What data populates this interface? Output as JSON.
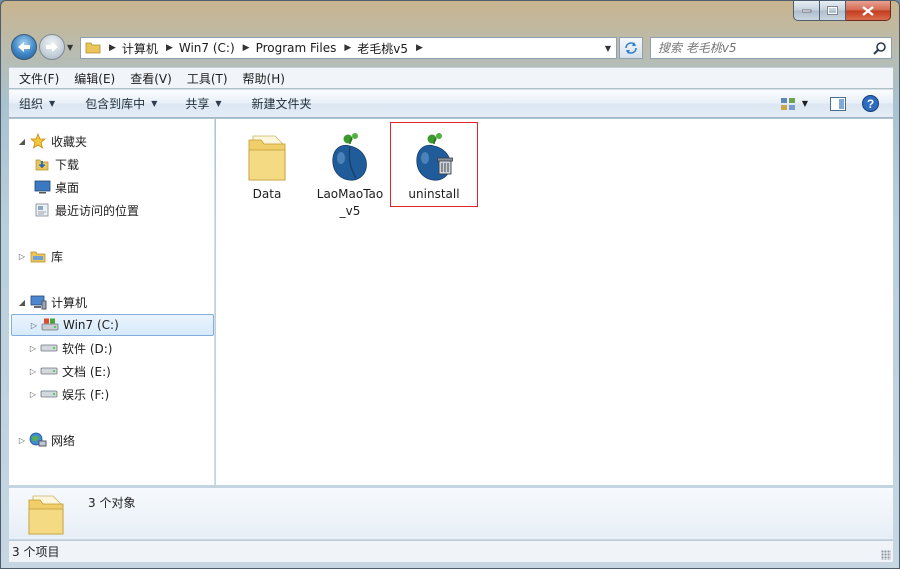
{
  "window": {
    "caption_buttons": [
      "minimize",
      "maximize",
      "close"
    ]
  },
  "address": {
    "crumbs": [
      "计算机",
      "Win7 (C:)",
      "Program Files",
      "老毛桃v5"
    ]
  },
  "search": {
    "placeholder": "搜索 老毛桃v5"
  },
  "menubar": {
    "items": [
      "文件(F)",
      "编辑(E)",
      "查看(V)",
      "工具(T)",
      "帮助(H)"
    ]
  },
  "commands": {
    "organize": "组织",
    "include_library": "包含到库中",
    "share": "共享",
    "new_folder": "新建文件夹"
  },
  "nav": {
    "favorites": "收藏夹",
    "downloads": "下载",
    "desktop": "桌面",
    "recent": "最近访问的位置",
    "libraries": "库",
    "computer": "计算机",
    "drive_c": "Win7 (C:)",
    "drive_d": "软件 (D:)",
    "drive_e": "文档 (E:)",
    "drive_f": "娱乐 (F:)",
    "network": "网络"
  },
  "files": [
    {
      "name": "Data",
      "icon": "folder-icon"
    },
    {
      "name": "LaoMaoTao_v5",
      "icon": "peach-app-icon"
    },
    {
      "name": "uninstall",
      "icon": "peach-uninstall-icon"
    }
  ],
  "details": {
    "summary": "3 个对象"
  },
  "status": {
    "count": "3 个项目"
  },
  "colors": {
    "highlight": "#e0242c",
    "selection": "#d7eafb",
    "peach": "#1f5c99",
    "leaf": "#3a9a2e"
  }
}
